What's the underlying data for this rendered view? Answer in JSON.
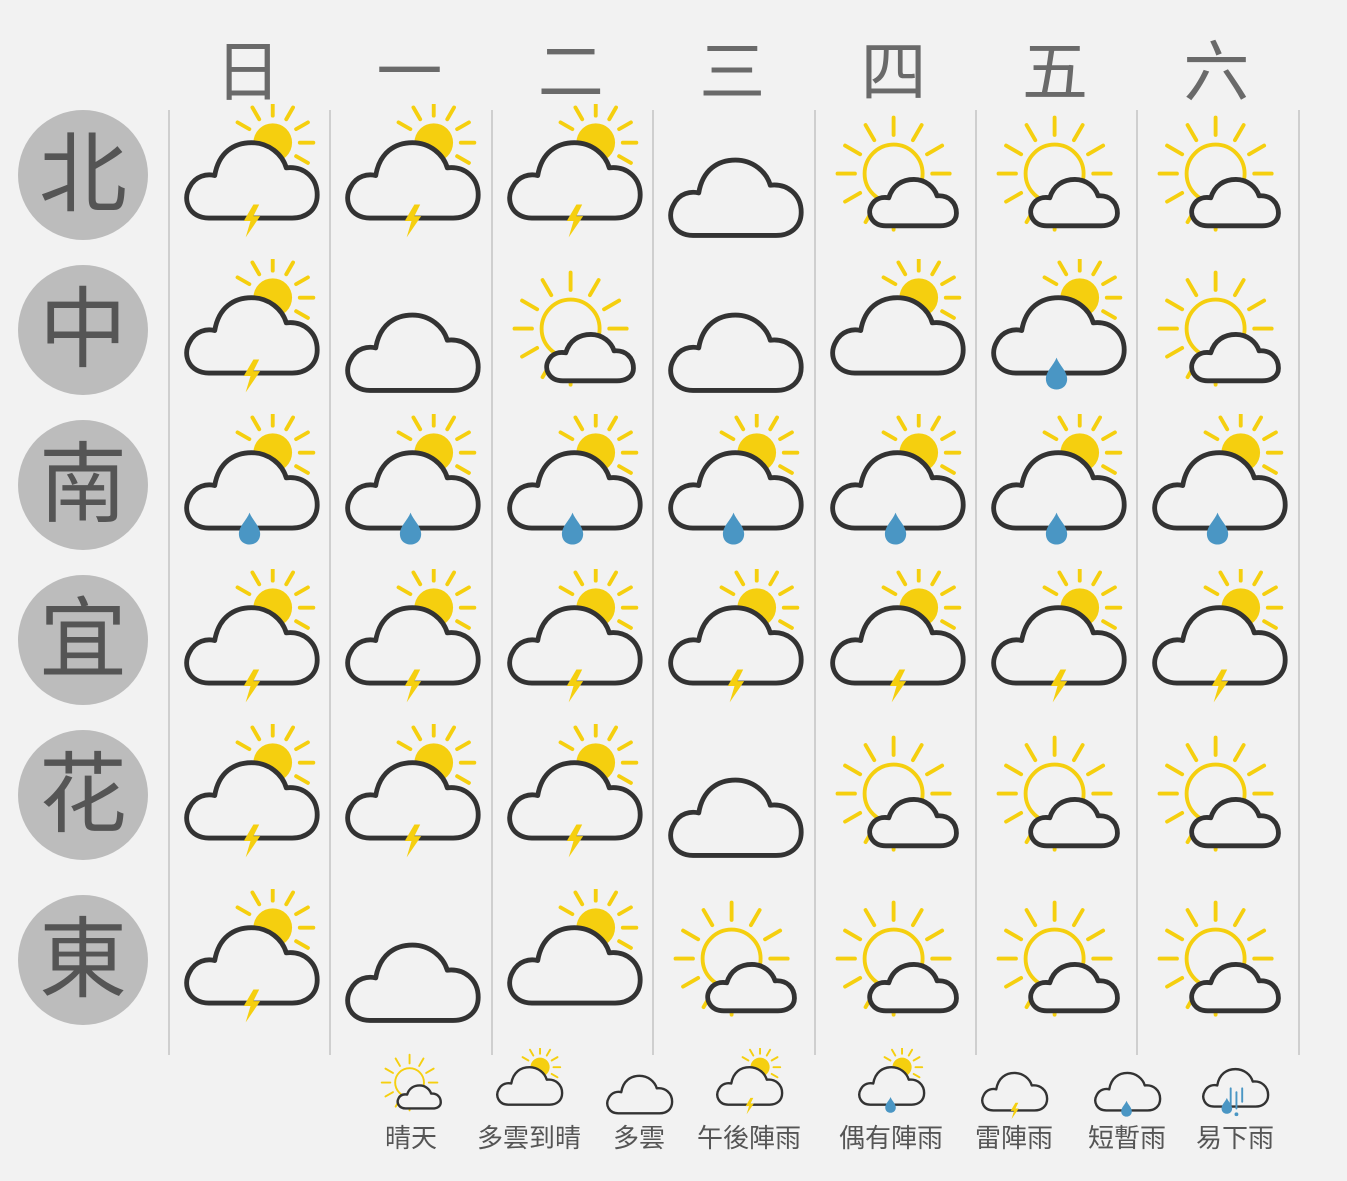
{
  "days": [
    "日",
    "一",
    "二",
    "三",
    "四",
    "五",
    "六"
  ],
  "regions": [
    {
      "label": "北",
      "forecast": [
        "thunder-afternoon",
        "thunder-afternoon",
        "thunder-afternoon",
        "cloudy",
        "sunny",
        "sunny",
        "sunny"
      ]
    },
    {
      "label": "中",
      "forecast": [
        "thunder-afternoon",
        "cloudy",
        "sunny",
        "cloudy",
        "cloudy-clearing",
        "occasional-showers",
        "sunny"
      ]
    },
    {
      "label": "南",
      "forecast": [
        "occasional-showers",
        "occasional-showers",
        "occasional-showers",
        "occasional-showers",
        "occasional-showers",
        "occasional-showers",
        "occasional-showers"
      ]
    },
    {
      "label": "宜",
      "forecast": [
        "thunder-afternoon",
        "thunder-afternoon",
        "thunder-afternoon",
        "thunder-afternoon",
        "thunder-afternoon",
        "thunder-afternoon",
        "thunder-afternoon"
      ]
    },
    {
      "label": "花",
      "forecast": [
        "thunder-afternoon",
        "thunder-afternoon",
        "thunder-afternoon",
        "cloudy",
        "sunny",
        "sunny",
        "sunny"
      ]
    },
    {
      "label": "東",
      "forecast": [
        "thunder-afternoon",
        "cloudy",
        "cloudy-clearing",
        "sunny",
        "sunny",
        "sunny",
        "sunny"
      ]
    }
  ],
  "legend": [
    {
      "icon": "sunny",
      "label": "晴天"
    },
    {
      "icon": "cloudy-clearing",
      "label": "多雲到晴"
    },
    {
      "icon": "cloudy",
      "label": "多雲"
    },
    {
      "icon": "thunder-afternoon",
      "label": "午後陣雨"
    },
    {
      "icon": "occasional-showers",
      "label": "偶有陣雨"
    },
    {
      "icon": "thunder-showers",
      "label": "雷陣雨"
    },
    {
      "icon": "brief-rain",
      "label": "短暫雨"
    },
    {
      "icon": "rain",
      "label": "易下雨"
    }
  ],
  "colors": {
    "sun": "#f5cf0f",
    "cloud_outline": "#333333",
    "lightning": "#f5cf0f",
    "raindrop": "#4a96c4",
    "badge": "#bcbcbc"
  }
}
